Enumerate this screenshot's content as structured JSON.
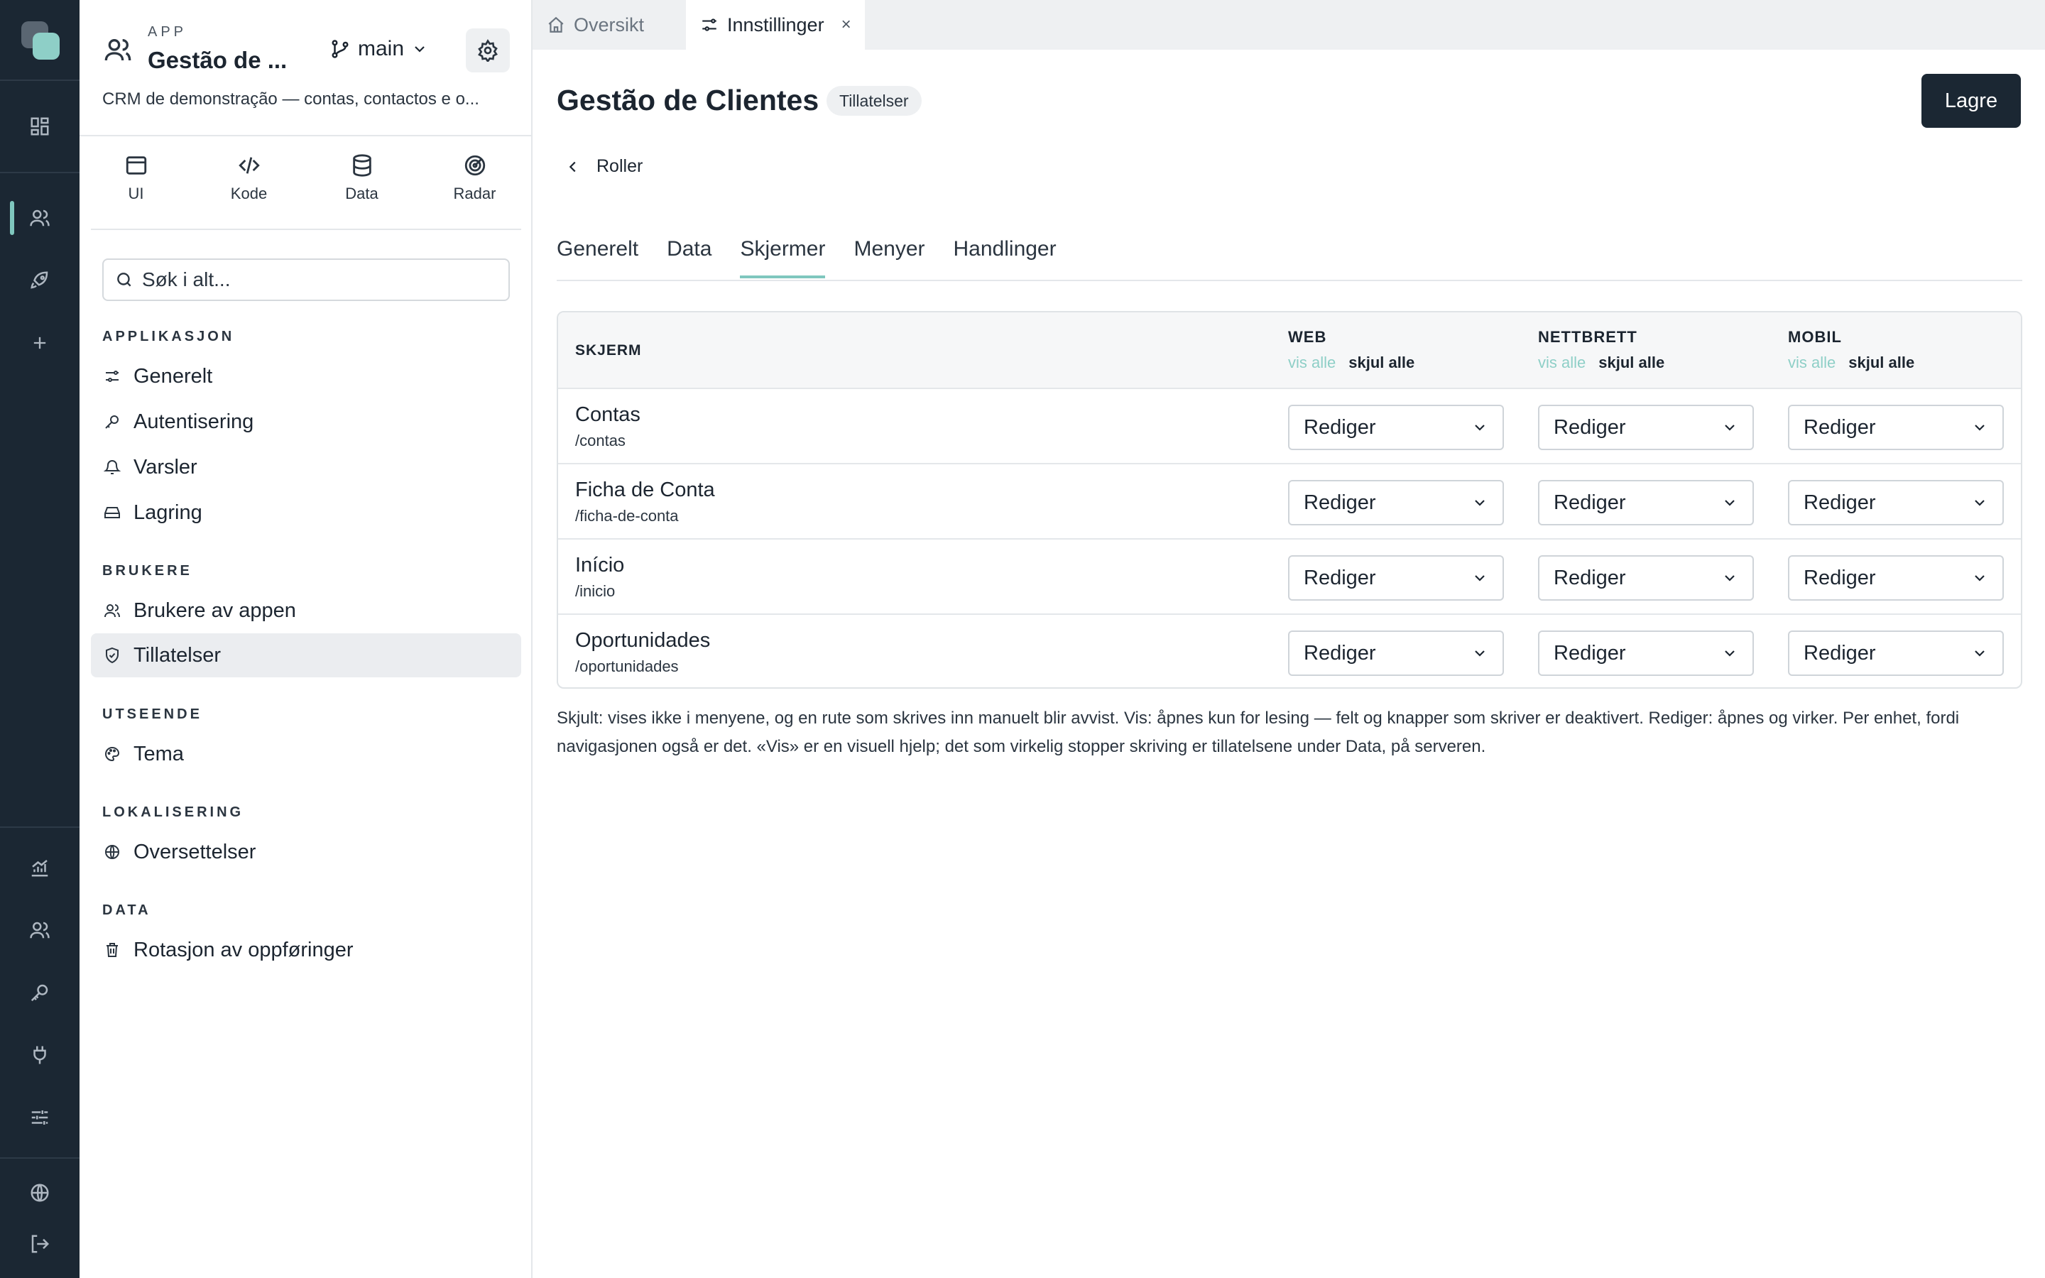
{
  "app": {
    "label": "APP",
    "name": "Gestão de ...",
    "branch": "main",
    "description": "CRM de demonstração — contas, contactos e o..."
  },
  "tools": [
    {
      "label": "UI",
      "icon": "window-icon"
    },
    {
      "label": "Kode",
      "icon": "code-icon"
    },
    {
      "label": "Data",
      "icon": "database-icon"
    },
    {
      "label": "Radar",
      "icon": "radar-icon"
    }
  ],
  "search": {
    "placeholder": "Søk i alt..."
  },
  "nav": {
    "applikasjon": {
      "title": "APPLIKASJON",
      "items": [
        "Generelt",
        "Autentisering",
        "Varsler",
        "Lagring"
      ]
    },
    "brukere": {
      "title": "BRUKERE",
      "items": [
        "Brukere av appen",
        "Tillatelser"
      ]
    },
    "utseende": {
      "title": "UTSEENDE",
      "items": [
        "Tema"
      ]
    },
    "lokalisering": {
      "title": "LOKALISERING",
      "items": [
        "Oversettelser"
      ]
    },
    "data": {
      "title": "DATA",
      "items": [
        "Rotasjon av oppføringer"
      ]
    },
    "active_item": "Tillatelser"
  },
  "tabs": [
    {
      "label": "Oversikt",
      "icon": "home-icon"
    },
    {
      "label": "Innstillinger",
      "icon": "sliders-icon",
      "active": true,
      "close": "×"
    }
  ],
  "page": {
    "title": "Gestão de Clientes",
    "badge": "Tillatelser",
    "save_label": "Lagre",
    "back_label": "Roller"
  },
  "sub_tabs": [
    {
      "label": "Generelt"
    },
    {
      "label": "Data"
    },
    {
      "label": "Skjermer",
      "active": true
    },
    {
      "label": "Menyer"
    },
    {
      "label": "Handlinger"
    }
  ],
  "table": {
    "screen_header": "SKJERM",
    "columns": [
      {
        "label": "WEB",
        "show_all": "vis alle",
        "hide_all": "skjul alle"
      },
      {
        "label": "NETTBRETT",
        "show_all": "vis alle",
        "hide_all": "skjul alle"
      },
      {
        "label": "MOBIL",
        "show_all": "vis alle",
        "hide_all": "skjul alle"
      }
    ],
    "rows": [
      {
        "name": "Contas",
        "path": "/contas",
        "web": "Rediger",
        "tablet": "Rediger",
        "mobile": "Rediger"
      },
      {
        "name": "Ficha de Conta",
        "path": "/ficha-de-conta",
        "web": "Rediger",
        "tablet": "Rediger",
        "mobile": "Rediger"
      },
      {
        "name": "Início",
        "path": "/inicio",
        "web": "Rediger",
        "tablet": "Rediger",
        "mobile": "Rediger"
      },
      {
        "name": "Oportunidades",
        "path": "/oportunidades",
        "web": "Rediger",
        "tablet": "Rediger",
        "mobile": "Rediger"
      }
    ]
  },
  "help_text": "Skjult: vises ikke i menyene, og en rute som skrives inn manuelt blir avvist. Vis: åpnes kun for lesing — felt og knapper som skriver er deaktivert. Rediger: åpnes og virker. Per enhet, fordi navigasjonen også er det. «Vis» er en visuell hjelp; det som virkelig stopper skriving er tillatelsene under Data, på serveren.",
  "colors": {
    "accent": "#7fc7be",
    "rail": "#1b2733",
    "primary_button": "#1b2733"
  }
}
